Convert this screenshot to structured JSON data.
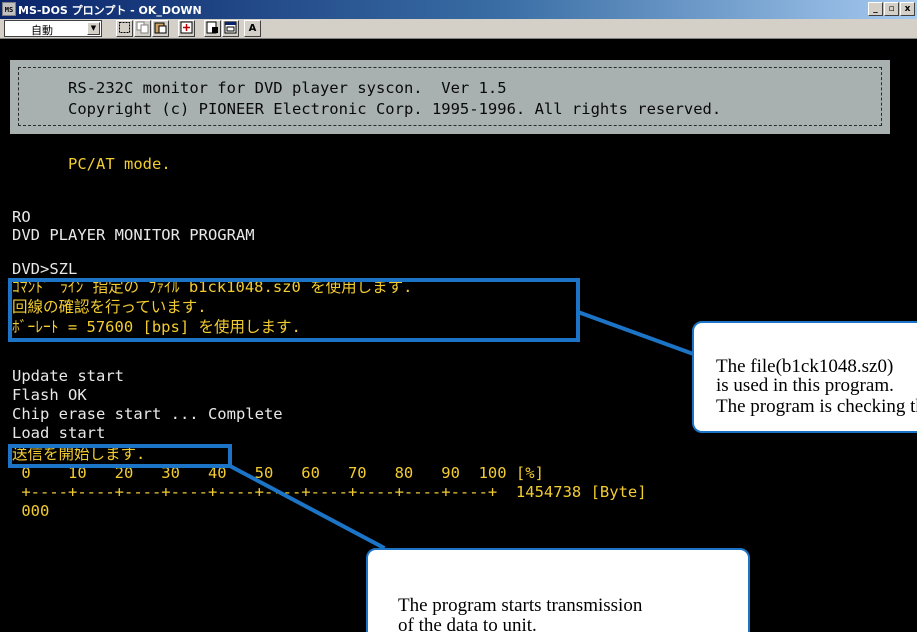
{
  "window": {
    "title": "MS-DOS プロンプト - OK_DOWN",
    "icon_text": "MS",
    "buttons": [
      "minimize",
      "maximize",
      "close"
    ],
    "minimize_glyph": "_",
    "maximize_glyph": "▫",
    "close_glyph": "x"
  },
  "toolbar": {
    "font_select": "自動",
    "font_select_arrow": "▼",
    "font_button_label": "A",
    "icons": [
      "mark-icon",
      "copy-icon",
      "paste-icon",
      "fullscreen-icon",
      "properties-icon",
      "background-icon",
      "font-icon"
    ]
  },
  "console": {
    "banner": {
      "line1": "RS-232C monitor for DVD player syscon.  Ver 1.5",
      "line2": "Copyright (c) PIONEER Electronic Corp. 1995-1996. All rights reserved."
    },
    "mode_line": "PC/AT mode.",
    "lines_top": [
      "RO",
      "DVD PLAYER MONITOR PROGRAM"
    ],
    "prompt": "DVD>SZL",
    "japanese_lines": [
      "ｺﾏﾝﾄﾞ ﾗｲﾝ 指定の ﾌｧｲﾙ b1ck1048.sz0 を使用します.",
      "回線の確認を行っています.",
      "ﾎﾞｰﾚｰﾄ = 57600 [bps] を使用します."
    ],
    "update_lines": [
      "Update start",
      "Flash OK",
      "Chip erase start ... Complete",
      "Load start"
    ],
    "transmit_line": "送信を開始します.",
    "progress_scale": " 0    10   20   30   40   50   60   70   80   90  100 [%]",
    "progress_bar": " +----+----+----+----+----+----+----+----+----+----+  1454738 [Byte]",
    "progress_value": " 000"
  },
  "callouts": {
    "right": {
      "line1": "The file(b1ck1048.sz0)",
      "line2": "is used in this program.",
      "line3": "The program is checking the line."
    },
    "bottom": {
      "line1": "The program starts transmission",
      "line2": "of the data to unit."
    }
  },
  "colors": {
    "title_bar": "#0a246a",
    "console_bg": "#000000",
    "text_white": "#e8e8e8",
    "text_yellow": "#f2cc30",
    "banner_bg": "#a8b0b0",
    "callout_border": "#1b74c6"
  }
}
